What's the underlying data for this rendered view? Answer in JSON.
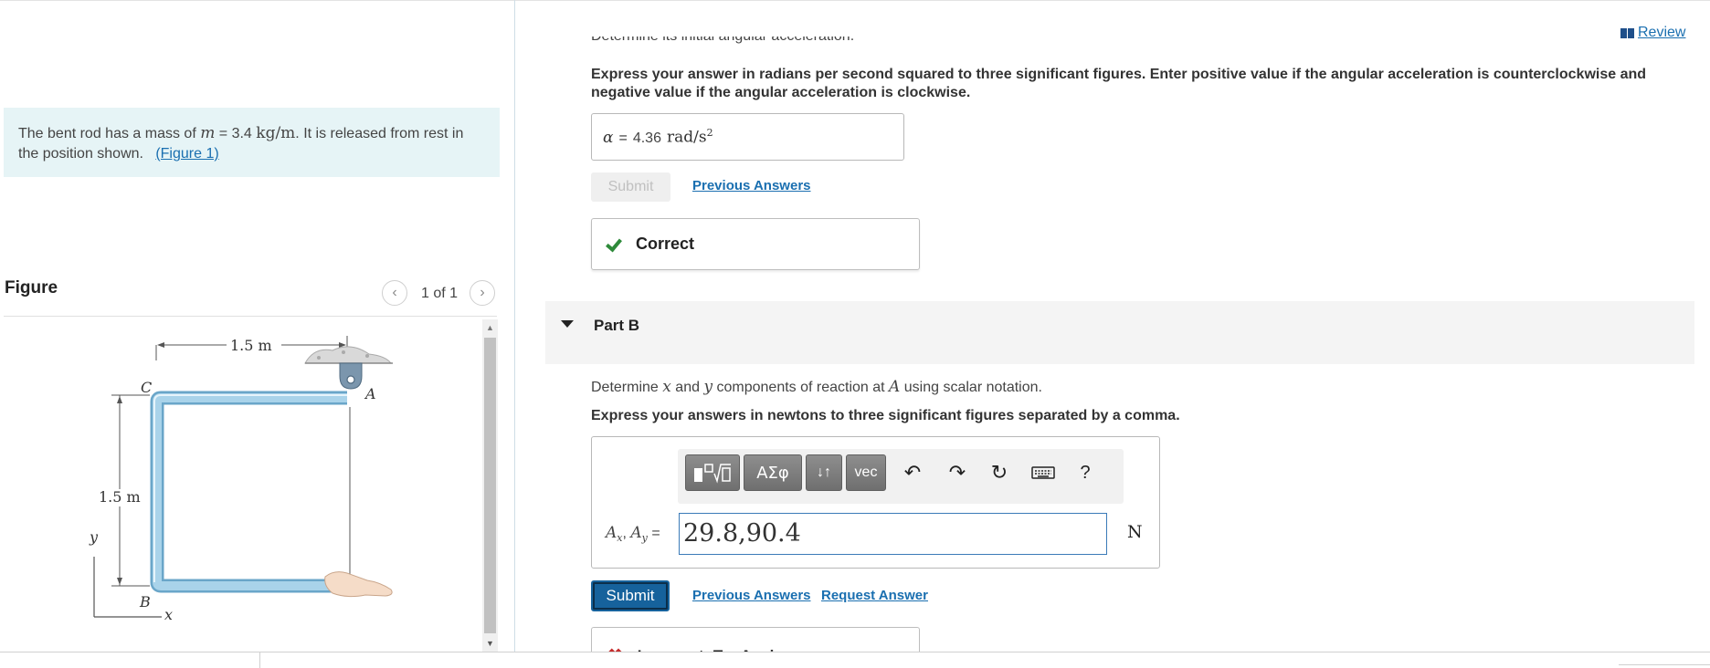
{
  "problem": {
    "text_before": "The bent rod has a mass of ",
    "var_m": "m",
    "equals": " = 3.4 ",
    "unit": "kg/m",
    "text_after": ". It is released from rest in the position shown.",
    "figure_link": "(Figure 1)"
  },
  "figure": {
    "title": "Figure",
    "page_indicator": "1 of 1",
    "prev_icon": "chevron-left-icon",
    "next_icon": "chevron-right-icon",
    "labels": {
      "top_dim": "1.5 m",
      "side_dim": "1.5 m",
      "point_c": "C",
      "point_a": "A",
      "point_b": "B",
      "axis_x": "x",
      "axis_y": "y"
    }
  },
  "header": {
    "review_label": "Review",
    "review_icon": "book-icon"
  },
  "part_a": {
    "cut_question": "Determine its initial angular acceleration.",
    "instruction": "Express your answer in radians per second squared to three significant figures. Enter positive value if the angular acceleration is counterclockwise and negative value if the angular acceleration is clockwise.",
    "answer_var": "α",
    "answer_eq": "=",
    "answer_value": "4.36",
    "answer_unit": "rad/s",
    "answer_unit_exp": "2",
    "submit_label": "Submit",
    "previous_answers_label": "Previous Answers",
    "feedback": "Correct",
    "feedback_icon": "check-icon"
  },
  "part_b": {
    "title": "Part B",
    "caret_icon": "caret-down-icon",
    "question_prefix": "Determine ",
    "question_x": "x",
    "question_and": " and ",
    "question_y": "y",
    "question_mid": " components of reaction at ",
    "question_a": "A",
    "question_suffix": " using scalar notation.",
    "instruction": "Express your answers in newtons to three significant figures separated by a comma.",
    "toolbar": {
      "templates_icon": "templates-icon",
      "greek_label": "ΑΣφ",
      "arrows_label": "↓↑",
      "vec_label": "vec",
      "undo_icon": "undo-icon",
      "redo_icon": "redo-icon",
      "reset_icon": "reset-icon",
      "keyboard_icon": "keyboard-icon",
      "help_label": "?"
    },
    "answer_label_ax": "A",
    "answer_sub_x": "x",
    "answer_label_sep": ", ",
    "answer_label_ay": "A",
    "answer_sub_y": "y",
    "answer_eq": "=",
    "answer_value": "29.8,90.4",
    "answer_unit": "N",
    "submit_label": "Submit",
    "previous_answers_label": "Previous Answers",
    "request_answer_label": "Request Answer",
    "feedback": "Incorrect; Try Again",
    "feedback_icon": "x-mark-icon"
  },
  "colors": {
    "link": "#1a6fb0",
    "problem_bg": "#e6f4f6",
    "submit_bg": "#16629c",
    "correct": "#2e8a3a",
    "incorrect": "#c62b2b",
    "rod": "#9fcbe3"
  }
}
